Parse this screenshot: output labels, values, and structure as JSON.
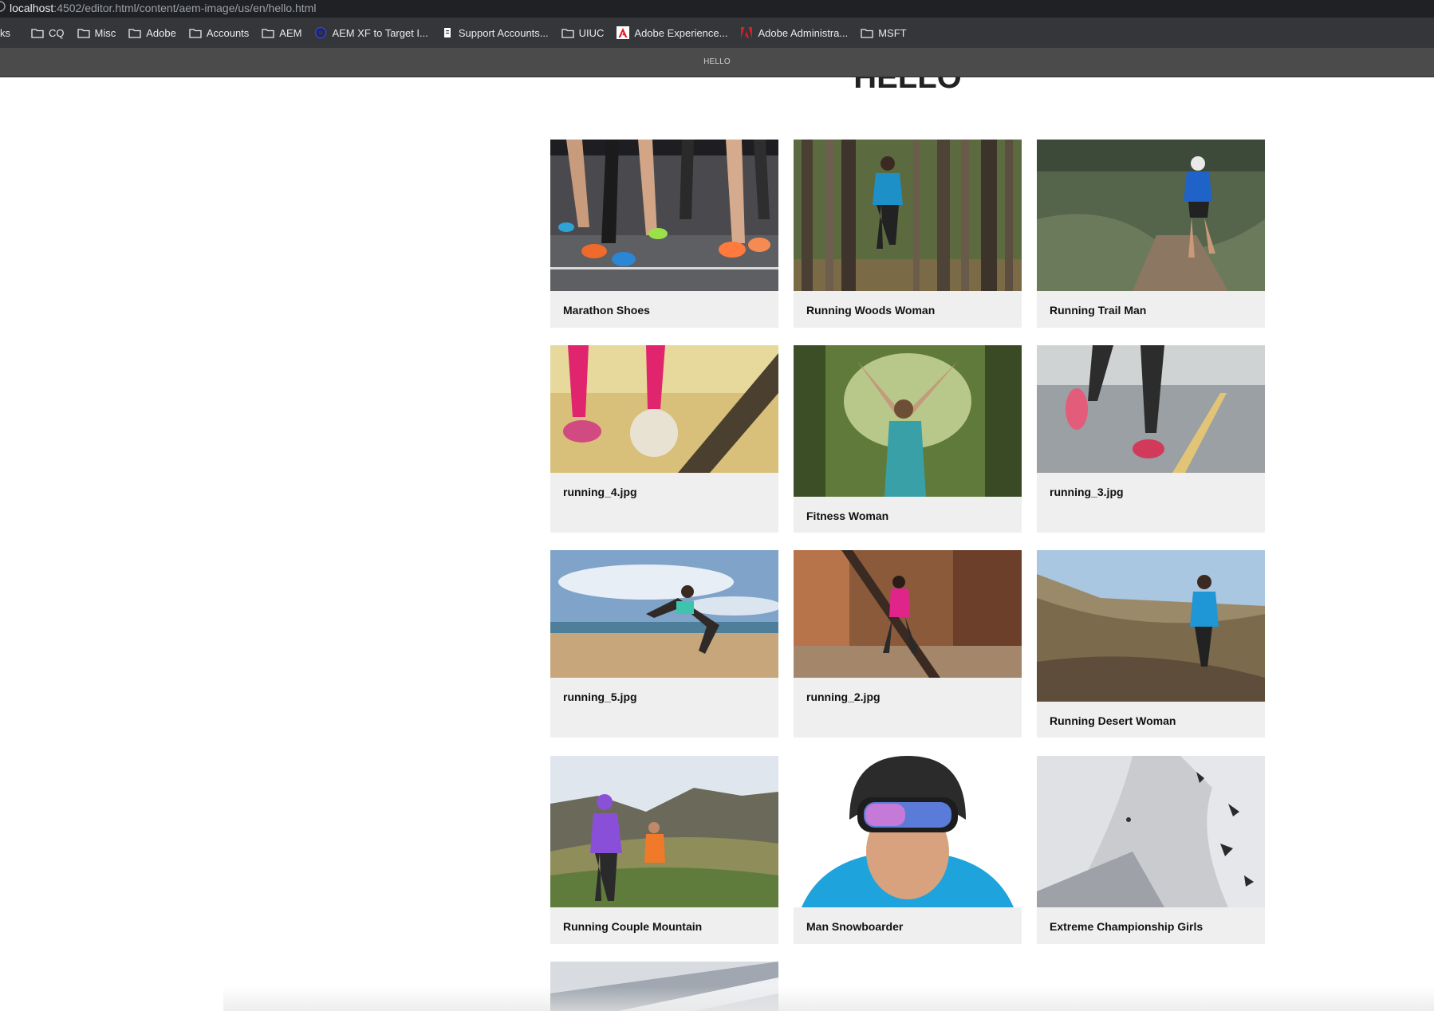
{
  "browser": {
    "url_host": "localhost",
    "url_path": ":4502/editor.html/content/aem-image/us/en/hello.html",
    "bookmarks": [
      {
        "label": "ks",
        "icon": "none"
      },
      {
        "label": "CQ",
        "icon": "folder-icon"
      },
      {
        "label": "Misc",
        "icon": "folder-icon"
      },
      {
        "label": "Adobe",
        "icon": "folder-icon"
      },
      {
        "label": "Accounts",
        "icon": "folder-icon"
      },
      {
        "label": "AEM",
        "icon": "folder-icon"
      },
      {
        "label": "AEM XF to Target I...",
        "icon": "globe-icon"
      },
      {
        "label": "Support Accounts...",
        "icon": "page-icon"
      },
      {
        "label": "UIUC",
        "icon": "folder-icon"
      },
      {
        "label": "Adobe Experience...",
        "icon": "adobe-logo-icon"
      },
      {
        "label": "Adobe Administra...",
        "icon": "adobe-logo-icon"
      },
      {
        "label": "MSFT",
        "icon": "folder-icon"
      }
    ]
  },
  "editor": {
    "page_title": "HELLO"
  },
  "page": {
    "heading": "HELLO",
    "cards": [
      {
        "caption": "Marathon Shoes",
        "image": "marathon-shoes"
      },
      {
        "caption": "Running Woods Woman",
        "image": "running-woods-woman"
      },
      {
        "caption": "Running Trail Man",
        "image": "running-trail-man"
      },
      {
        "caption": "running_4.jpg",
        "image": "running-4"
      },
      {
        "caption": "Fitness Woman",
        "image": "fitness-woman"
      },
      {
        "caption": "running_3.jpg",
        "image": "running-3"
      },
      {
        "caption": "running_5.jpg",
        "image": "running-5"
      },
      {
        "caption": "running_2.jpg",
        "image": "running-2"
      },
      {
        "caption": "Running Desert Woman",
        "image": "running-desert-woman"
      },
      {
        "caption": "Running Couple Mountain",
        "image": "running-couple-mountain"
      },
      {
        "caption": "Man Snowboarder",
        "image": "man-snowboarder"
      },
      {
        "caption": "Extreme Championship Girls",
        "image": "extreme-championship-girls"
      },
      {
        "caption": "",
        "image": "snow-slope"
      }
    ]
  },
  "colors": {
    "card_bg": "#efefef",
    "bookmarks_bar": "#35363a",
    "title_strip": "#4b4b4b"
  }
}
